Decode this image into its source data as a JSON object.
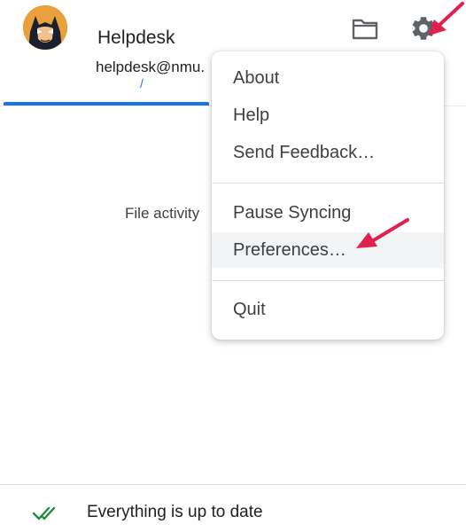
{
  "account": {
    "name": "Helpdesk",
    "email": "helpdesk@nmu."
  },
  "toolbar": {
    "folder_icon": "folder-icon",
    "settings_icon": "gear-icon"
  },
  "activity": {
    "tab_fragment": "/",
    "message": "File activity"
  },
  "menu": {
    "items": [
      {
        "label": "About"
      },
      {
        "label": "Help"
      },
      {
        "label": "Send Feedback…"
      },
      {
        "label": "Pause Syncing"
      },
      {
        "label": "Preferences…"
      },
      {
        "label": "Quit"
      }
    ]
  },
  "footer": {
    "status": "Everything is up to date",
    "status_icon": "double-check-icon"
  },
  "colors": {
    "accent": "#1a73e8",
    "annotation_arrow": "#e0204e",
    "status_ok": "#1e8e3e"
  }
}
